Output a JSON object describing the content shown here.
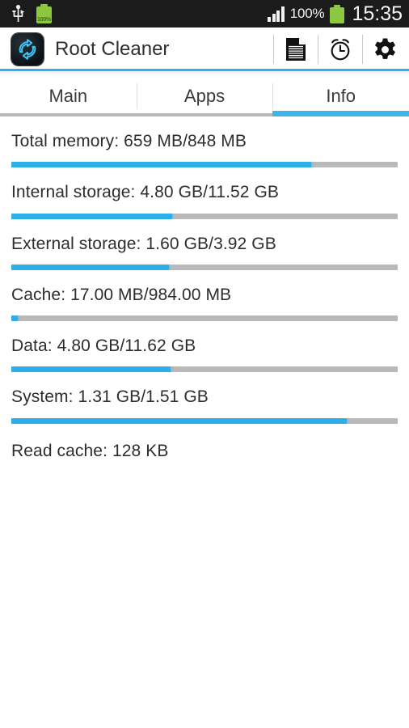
{
  "status_bar": {
    "usb_icon": "usb-icon",
    "left_battery_icon": "battery-charging-icon",
    "left_battery_percent": "100%",
    "signal_icon": "signal-bars-icon",
    "battery_percent": "100%",
    "battery_icon": "battery-icon",
    "time": "15:35"
  },
  "header": {
    "app_icon": "root-cleaner-app-icon",
    "title": "Root Cleaner",
    "actions": [
      {
        "name": "log-icon",
        "label": "Log"
      },
      {
        "name": "alarm-clock-icon",
        "label": "Scheduler"
      },
      {
        "name": "gear-icon",
        "label": "Settings"
      }
    ]
  },
  "tabs": [
    {
      "label": "Main",
      "active": false
    },
    {
      "label": "Apps",
      "active": false
    },
    {
      "label": "Info",
      "active": true
    }
  ],
  "info_rows": [
    {
      "label": "Total memory: 659 MB/848 MB",
      "name": "total-memory",
      "has_bar": true,
      "percent": 77.7
    },
    {
      "label": "Internal storage: 4.80 GB/11.52 GB",
      "name": "internal-storage",
      "has_bar": true,
      "percent": 41.7
    },
    {
      "label": "External storage: 1.60 GB/3.92 GB",
      "name": "external-storage",
      "has_bar": true,
      "percent": 40.8
    },
    {
      "label": "Cache: 17.00 MB/984.00 MB",
      "name": "cache",
      "has_bar": true,
      "percent": 1.7
    },
    {
      "label": "Data: 4.80 GB/11.62 GB",
      "name": "data",
      "has_bar": true,
      "percent": 41.3
    },
    {
      "label": "System: 1.31 GB/1.51 GB",
      "name": "system",
      "has_bar": true,
      "percent": 86.8
    },
    {
      "label": "Read cache: 128 KB",
      "name": "read-cache",
      "has_bar": false,
      "percent": 0
    }
  ],
  "colors": {
    "accent_blue": "#2cafe6",
    "tab_active_blue": "#3db5e6",
    "header_rule_blue": "#29b3e8",
    "track_gray": "#b9b9b9",
    "status_bar_bg": "#1b1b1b",
    "battery_green": "#8dc63f",
    "text_primary": "#2d2d2d"
  }
}
